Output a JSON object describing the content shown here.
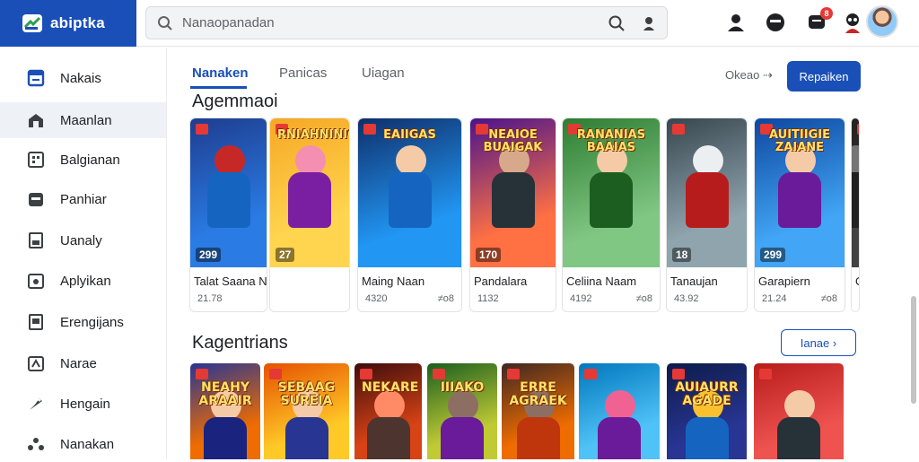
{
  "app": {
    "name": "abiptka"
  },
  "search": {
    "placeholder": "Nanaopanadan"
  },
  "header": {
    "notification_count": "8"
  },
  "sidebar": {
    "items": [
      {
        "label": "Nakais",
        "icon": "window-icon"
      },
      {
        "label": "Maanlan",
        "icon": "home-icon",
        "active": true
      },
      {
        "label": "Balgianan",
        "icon": "grid-icon"
      },
      {
        "label": "Panhiar",
        "icon": "box-icon"
      },
      {
        "label": "Uanaly",
        "icon": "download-icon"
      },
      {
        "label": "Aplyikan",
        "icon": "app-icon"
      },
      {
        "label": "Erengijans",
        "icon": "book-icon"
      },
      {
        "label": "Narae",
        "icon": "gamepad-icon"
      },
      {
        "label": "Hengain",
        "icon": "tag-icon"
      },
      {
        "label": "Nanakan",
        "icon": "more-icon"
      }
    ]
  },
  "tabs": [
    {
      "label": "Nanaken",
      "active": true
    },
    {
      "label": "Panicas"
    },
    {
      "label": "Uiagan"
    }
  ],
  "toolbar": {
    "filter_link": "Okeao",
    "filter_button": "Repaiken"
  },
  "section1": {
    "title": "Agemmaoi",
    "cards": [
      {
        "name": "Talat Saana Nalnais",
        "meta": "21.78",
        "price": "",
        "rating": "299",
        "art_title": "",
        "palette": [
          "#1e3d8f",
          "#2a7be4",
          "#c62828",
          "#1565c0"
        ]
      },
      {
        "name": "",
        "meta": "",
        "price": "",
        "rating": "27",
        "art_title": "RNIAHNINIG",
        "palette": [
          "#f6a825",
          "#ffd54f",
          "#f48fb1",
          "#7b1fa2"
        ]
      },
      {
        "name": "Maing Naan",
        "meta": "4320",
        "price": "≠o8",
        "rating": "",
        "art_title": "EAIIGAS",
        "palette": [
          "#0f2f6b",
          "#2196f3",
          "#f5cba7",
          "#1565c0"
        ]
      },
      {
        "name": "Pandalara",
        "meta": "1132",
        "price": "",
        "rating": "170",
        "art_title": "NEAIOE BUAIGAK",
        "palette": [
          "#4a148c",
          "#ff7043",
          "#d7a98a",
          "#263238"
        ]
      },
      {
        "name": "Celiina Naam",
        "meta": "4192",
        "price": "≠o8",
        "rating": "",
        "art_title": "RANANIAS BAAIAS",
        "palette": [
          "#2e7d32",
          "#81c784",
          "#f5cba7",
          "#1b5e20"
        ]
      },
      {
        "name": "Tanaujan",
        "meta": "43.92",
        "price": "",
        "rating": "18",
        "art_title": "",
        "palette": [
          "#37474f",
          "#90a4ae",
          "#eceff1",
          "#b71c1c"
        ]
      },
      {
        "name": "Garapiern",
        "meta": "21.24",
        "price": "≠o8",
        "rating": "299",
        "art_title": "AUITIIGIE ZAIANE",
        "palette": [
          "#0d47a1",
          "#42a5f5",
          "#f5cba7",
          "#6a1b9a"
        ]
      },
      {
        "name": "O",
        "meta": "",
        "price": "",
        "rating": "",
        "art_title": "",
        "palette": [
          "#212121",
          "#424242",
          "#757575",
          "#212121"
        ]
      }
    ]
  },
  "section2": {
    "title": "Kagentrians",
    "button": "Ianae",
    "tiles": [
      {
        "art_title": "NEAHY ARAAIR",
        "palette": [
          "#283593",
          "#ef6c00",
          "#f5cba7",
          "#1a237e"
        ]
      },
      {
        "art_title": "SEBAAG SUREIA",
        "palette": [
          "#e65100",
          "#ffca28",
          "#f5cba7",
          "#283593"
        ]
      },
      {
        "art_title": "NEKARE",
        "palette": [
          "#3e0d0d",
          "#d84315",
          "#ff8a65",
          "#4e342e"
        ]
      },
      {
        "art_title": "IIIAKO",
        "palette": [
          "#1b5e20",
          "#c0ca33",
          "#8d6e63",
          "#6a1b9a"
        ]
      },
      {
        "art_title": "ERRE AGRAEK",
        "palette": [
          "#3e2723",
          "#ef6c00",
          "#8d6e63",
          "#bf360c"
        ]
      },
      {
        "art_title": "",
        "palette": [
          "#0277bd",
          "#4fc3f7",
          "#f06292",
          "#6a1b9a"
        ]
      },
      {
        "art_title": "AUIAURR AGADE",
        "palette": [
          "#0d1b4a",
          "#283593",
          "#fbc02d",
          "#1565c0"
        ]
      },
      {
        "art_title": "",
        "palette": [
          "#b71c1c",
          "#ef5350",
          "#f5cba7",
          "#263238"
        ]
      }
    ]
  },
  "colors": {
    "brand": "#1a4fb8",
    "badge": "#e53935"
  }
}
